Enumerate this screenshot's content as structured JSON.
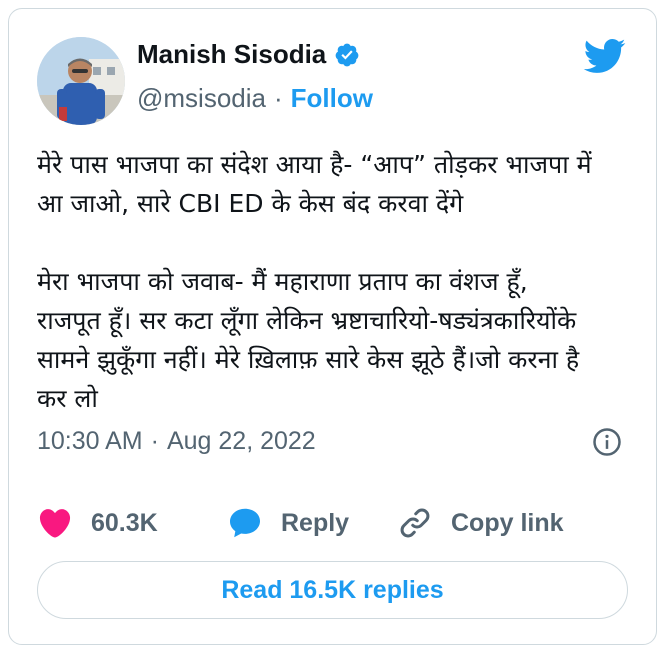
{
  "author": {
    "name": "Manish Sisodia",
    "handle": "@msisodia",
    "follow_label": "Follow",
    "separator": "·"
  },
  "tweet": {
    "lines": [
      "मेरे पास भाजपा का संदेश आया है- “आप” तोड़कर भाजपा में",
      "आ जाओ, सारे CBI ED के केस बंद करवा देंगे",
      "",
      "मेरा भाजपा को जवाब- मैं महाराणा प्रताप का वंशज हूँ,",
      "राजपूत हूँ। सर कटा लूँगा लेकिन भ्रष्टाचारियो-षड्यंत्रकारियोंके",
      "सामने झुकूँगा नहीं। मेरे ख़िलाफ़ सारे केस झूठे हैं।जो करना है",
      "कर लो"
    ],
    "time": "10:30 AM",
    "date_separator": "·",
    "date": "Aug 22, 2022"
  },
  "actions": {
    "like_count": "60.3K",
    "reply_label": "Reply",
    "copy_link_label": "Copy link"
  },
  "read_replies_label": "Read 16.5K replies",
  "icons": {
    "verified": "verified-badge-icon",
    "bird": "twitter-bird-icon",
    "info": "info-icon",
    "heart": "heart-icon",
    "reply": "speech-bubble-icon",
    "link": "link-icon"
  },
  "colors": {
    "accent": "#1d9bf0",
    "heart": "#f91880",
    "muted": "#536471",
    "text": "#0f1419",
    "border": "#cfd9de"
  }
}
